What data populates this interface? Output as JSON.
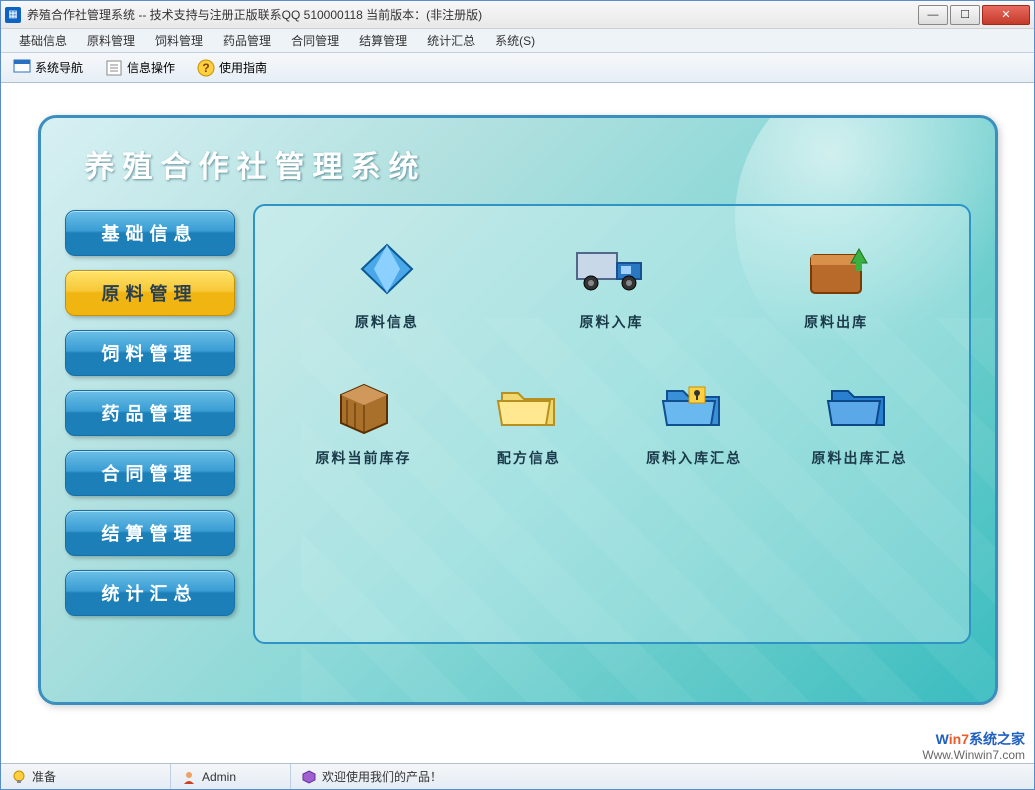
{
  "window": {
    "title": "养殖合作社管理系统 -- 技术支持与注册正版联系QQ 510000118   当前版本：(非注册版)"
  },
  "menubar": [
    "基础信息",
    "原料管理",
    "饲料管理",
    "药品管理",
    "合同管理",
    "结算管理",
    "统计汇总",
    "系统(S)"
  ],
  "toolbar": [
    {
      "icon": "nav-icon",
      "label": "系统导航"
    },
    {
      "icon": "info-icon",
      "label": "信息操作"
    },
    {
      "icon": "help-icon",
      "label": "使用指南"
    }
  ],
  "panel": {
    "title": "养殖合作社管理系统",
    "sidenav": [
      {
        "label": "基础信息",
        "active": false
      },
      {
        "label": "原料管理",
        "active": true
      },
      {
        "label": "饲料管理",
        "active": false
      },
      {
        "label": "药品管理",
        "active": false
      },
      {
        "label": "合同管理",
        "active": false
      },
      {
        "label": "结算管理",
        "active": false
      },
      {
        "label": "统计汇总",
        "active": false
      }
    ],
    "grid_row1": [
      {
        "icon": "diamond-icon",
        "label": "原料信息"
      },
      {
        "icon": "truck-icon",
        "label": "原料入库"
      },
      {
        "icon": "box-out-icon",
        "label": "原料出库"
      }
    ],
    "grid_row2": [
      {
        "icon": "crate-icon",
        "label": "原料当前库存"
      },
      {
        "icon": "folder-icon",
        "label": "配方信息"
      },
      {
        "icon": "folder-in-icon",
        "label": "原料入库汇总"
      },
      {
        "icon": "folder-out-icon",
        "label": "原料出库汇总"
      }
    ]
  },
  "statusbar": {
    "ready": "准备",
    "user": "Admin",
    "welcome": "欢迎使用我们的产品！"
  },
  "watermark": {
    "line1_pre": "W",
    "line1_em": "in7",
    "line1_post": "系统之家",
    "line2": "Www.Winwin7.com"
  }
}
